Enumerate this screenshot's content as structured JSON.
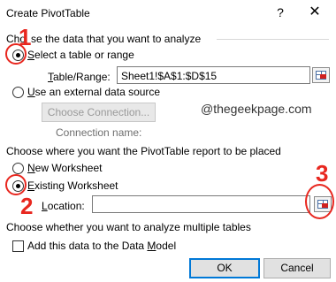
{
  "window": {
    "title": "Create PivotTable",
    "help_glyph": "?",
    "close_glyph": "✕"
  },
  "section_source": {
    "heading_pre": "Cho",
    "heading_post": "se the data that you want to analyze",
    "option_table": {
      "accel": "S",
      "rest": "elect a table or range",
      "checked": true
    },
    "table_range_label_accel": "T",
    "table_range_label_rest": "able/Range:",
    "table_range_value": "Sheet1!$A$1:$D$15",
    "option_external": {
      "accel": "U",
      "rest": "se an external data source",
      "checked": false
    },
    "choose_connection_label": "Choose Connection...",
    "connection_name_label": "Connection name:"
  },
  "watermark": "@thegeekpage.com",
  "section_placement": {
    "heading": "Choose where you want the PivotTable report to be placed",
    "option_new": {
      "accel": "N",
      "rest": "ew Worksheet",
      "checked": false
    },
    "option_existing": {
      "accel": "E",
      "rest": "xisting Worksheet",
      "checked": true
    },
    "location_label_accel": "L",
    "location_label_rest": "ocation:",
    "location_value": ""
  },
  "section_multiple": {
    "heading": "Choose whether you want to analyze multiple tables",
    "data_model_accel": "M",
    "data_model_pre": "Add this data to the Data ",
    "data_model_post": "odel",
    "data_model_checked": false
  },
  "buttons": {
    "ok": "OK",
    "cancel": "Cancel"
  },
  "annotations": {
    "one": "1",
    "two": "2",
    "three": "3",
    "color": "#e8271f"
  }
}
